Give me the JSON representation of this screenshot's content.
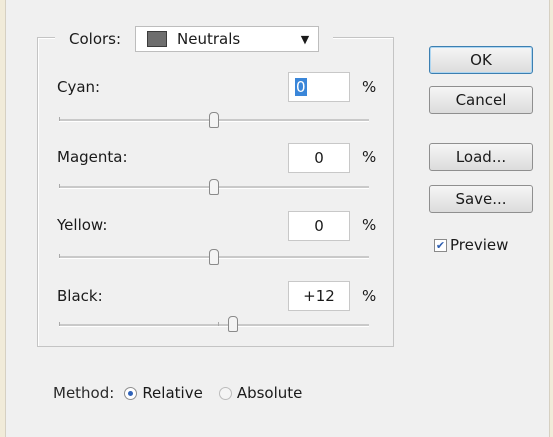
{
  "colors": {
    "label": "Colors:",
    "selected": "Neutrals",
    "swatch_color": "#6e6e6e",
    "arrow_icon": "triangle-down"
  },
  "rows": [
    {
      "label": "Cyan:",
      "value": "0",
      "unit": "%"
    },
    {
      "label": "Magenta:",
      "value": "0",
      "unit": "%"
    },
    {
      "label": "Yellow:",
      "value": "0",
      "unit": "%"
    },
    {
      "label": "Black:",
      "value": "+12",
      "unit": "%"
    }
  ],
  "buttons": {
    "ok": "OK",
    "cancel": "Cancel",
    "load": "Load...",
    "save": "Save..."
  },
  "preview": {
    "label": "Preview",
    "checked": true
  },
  "method": {
    "label": "Method:",
    "options": [
      "Relative",
      "Absolute"
    ],
    "selected": "Relative"
  }
}
